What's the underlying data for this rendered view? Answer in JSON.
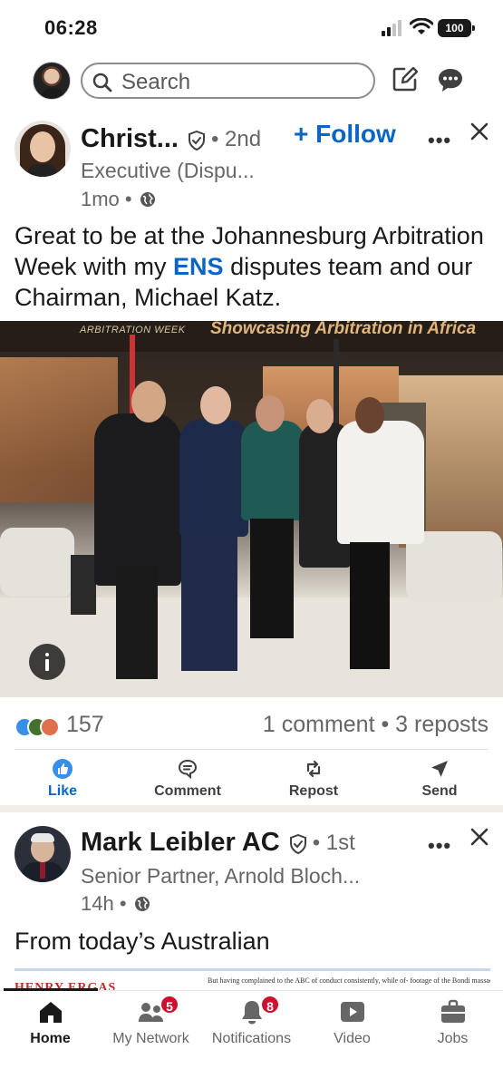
{
  "status_bar": {
    "time": "06:28",
    "battery": "100"
  },
  "top_bar": {
    "search_placeholder": "Search"
  },
  "posts": [
    {
      "author": "Christ...",
      "degree": "• 2nd",
      "follow_label": "+ Follow",
      "headline": "Executive (Dispu...",
      "time": "1mo •",
      "text_before": "Great to be at the Johannesburg Arbitration Week with my ",
      "mention": "ENS",
      "text_after": " disputes team and our Chairman, Michael Katz.",
      "image_banner": {
        "left": "ARBITRATION WEEK",
        "right": "Showcasing Arbitration in Africa"
      },
      "reactions_count": "157",
      "comments_reposts": "1 comment • 3 reposts",
      "actions": [
        {
          "label": "Like",
          "icon": "like-icon"
        },
        {
          "label": "Comment",
          "icon": "comment-icon"
        },
        {
          "label": "Repost",
          "icon": "repost-icon"
        },
        {
          "label": "Send",
          "icon": "send-icon"
        }
      ]
    },
    {
      "author": "Mark Leibler AC",
      "degree": "• 1st",
      "headline": "Senior Partner, Arnold Bloch...",
      "time": "14h •",
      "text": "From today’s Australian",
      "article_head": "HENRY ERGAS",
      "article_body": "But having complained to the ABC    of conduct consistently, while of-    footage of the Bondi massacre as"
    }
  ],
  "tabs": [
    {
      "label": "Home",
      "icon": "home-icon",
      "active": true,
      "badge": ""
    },
    {
      "label": "My Network",
      "icon": "network-icon",
      "active": false,
      "badge": "5"
    },
    {
      "label": "Notifications",
      "icon": "bell-icon",
      "active": false,
      "badge": "8"
    },
    {
      "label": "Video",
      "icon": "video-icon",
      "active": false,
      "badge": ""
    },
    {
      "label": "Jobs",
      "icon": "briefcase-icon",
      "active": false,
      "badge": ""
    }
  ],
  "colors": {
    "accent": "#0a66c2",
    "badge": "#cb112d",
    "text": "#191919",
    "muted": "#666666"
  }
}
